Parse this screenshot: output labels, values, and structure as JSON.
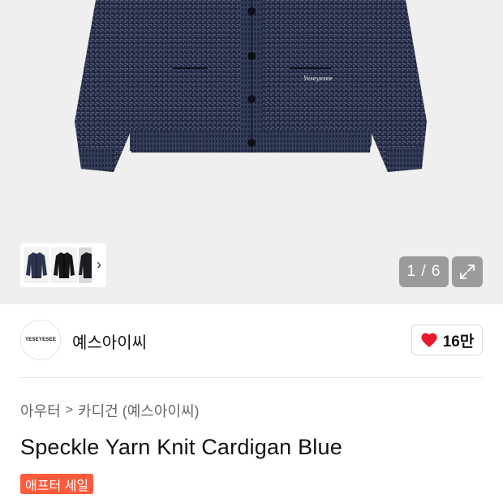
{
  "gallery": {
    "image_icon": "cardigan-photo",
    "counter": "1 / 6",
    "expand_icon": "expand-icon",
    "thumbnail_chevron": "›",
    "embroidery_text": "Yeseyesee"
  },
  "brand": {
    "logo_text": "YESEYESEE",
    "name": "예스아이씨",
    "like_count": "16만",
    "heart_color": "#e8192c"
  },
  "breadcrumb": {
    "level1": "아우터",
    "separator": ">",
    "level2": "카디건 (예스아이씨)"
  },
  "product": {
    "title": "Speckle Yarn Knit Cardigan Blue",
    "badge": "애프터 세일",
    "badge_color": "#ff5a3c"
  }
}
